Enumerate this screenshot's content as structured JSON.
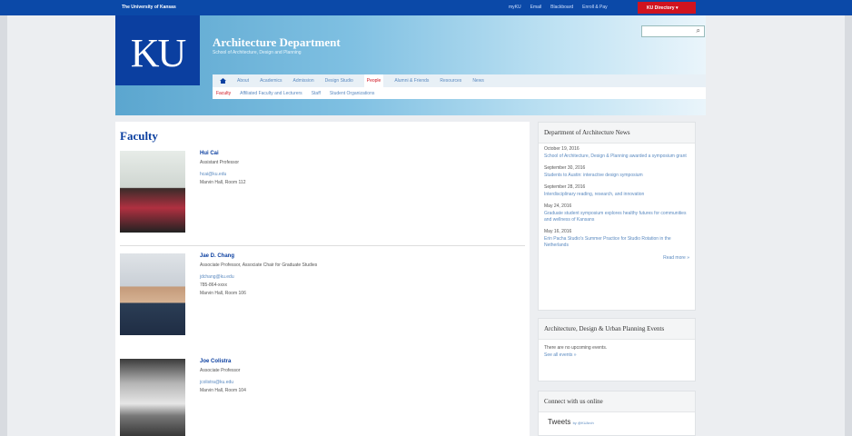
{
  "topbar": {
    "university": "The University of Kansas",
    "links": [
      "myKU",
      "Email",
      "Blackboard",
      "Enroll & Pay"
    ],
    "button": "KU Directory"
  },
  "header": {
    "logo": "KU",
    "department": "Architecture Department",
    "subtitle": "School of Architecture, Design and Planning",
    "search_placeholder": ""
  },
  "nav": {
    "items": [
      "About",
      "Academics",
      "Admission",
      "Design Studio",
      "People",
      "Alumni & Friends",
      "Resources",
      "News"
    ],
    "active": "People"
  },
  "subnav": {
    "items": [
      "Faculty",
      "Affiliated Faculty and Lecturers",
      "Staff",
      "Student Organizations"
    ]
  },
  "faculty": {
    "heading": "Faculty",
    "people": [
      {
        "name": "Hui Cai",
        "title": "Assistant Professor",
        "email": "hcai@ku.edu",
        "phone": "",
        "office": "Marvin Hall, Room 112"
      },
      {
        "name": "Jae D. Chang",
        "title": "Associate Professor, Associate Chair for Graduate Studies",
        "email": "jdchang@ku.edu",
        "phone": "785-864-xxxx",
        "office": "Marvin Hall, Room 106"
      },
      {
        "name": "Joe Colistra",
        "title": "Associate Professor",
        "email": "jcolistra@ku.edu",
        "phone": "",
        "office": "Marvin Hall, Room 104"
      }
    ]
  },
  "news": {
    "heading": "Department of Architecture News",
    "items": [
      {
        "date": "October 19, 2016",
        "text": "School of Architecture, Design & Planning awarded a symposium grant"
      },
      {
        "date": "September 30, 2016",
        "text": "Students to Austin: interactive design symposium"
      },
      {
        "date": "September 28, 2016",
        "text": "Interdisciplinary reading, research, and innovation"
      },
      {
        "date": "May 24, 2016",
        "text": "Graduate student symposium explores healthy futures for communities and wellness of Kansans"
      },
      {
        "date": "May 16, 2016",
        "text": "Erin Pacha Studio's Summer Practice for Studio Rotation in the Netherlands"
      }
    ],
    "read_more": "Read more »"
  },
  "events": {
    "heading": "Architecture, Design & Urban Planning Events",
    "empty": "There are no upcoming events.",
    "link": "See all events »"
  },
  "connect": {
    "heading": "Connect with us online",
    "tweets_label": "Tweets",
    "handle": "by @KUArch"
  }
}
